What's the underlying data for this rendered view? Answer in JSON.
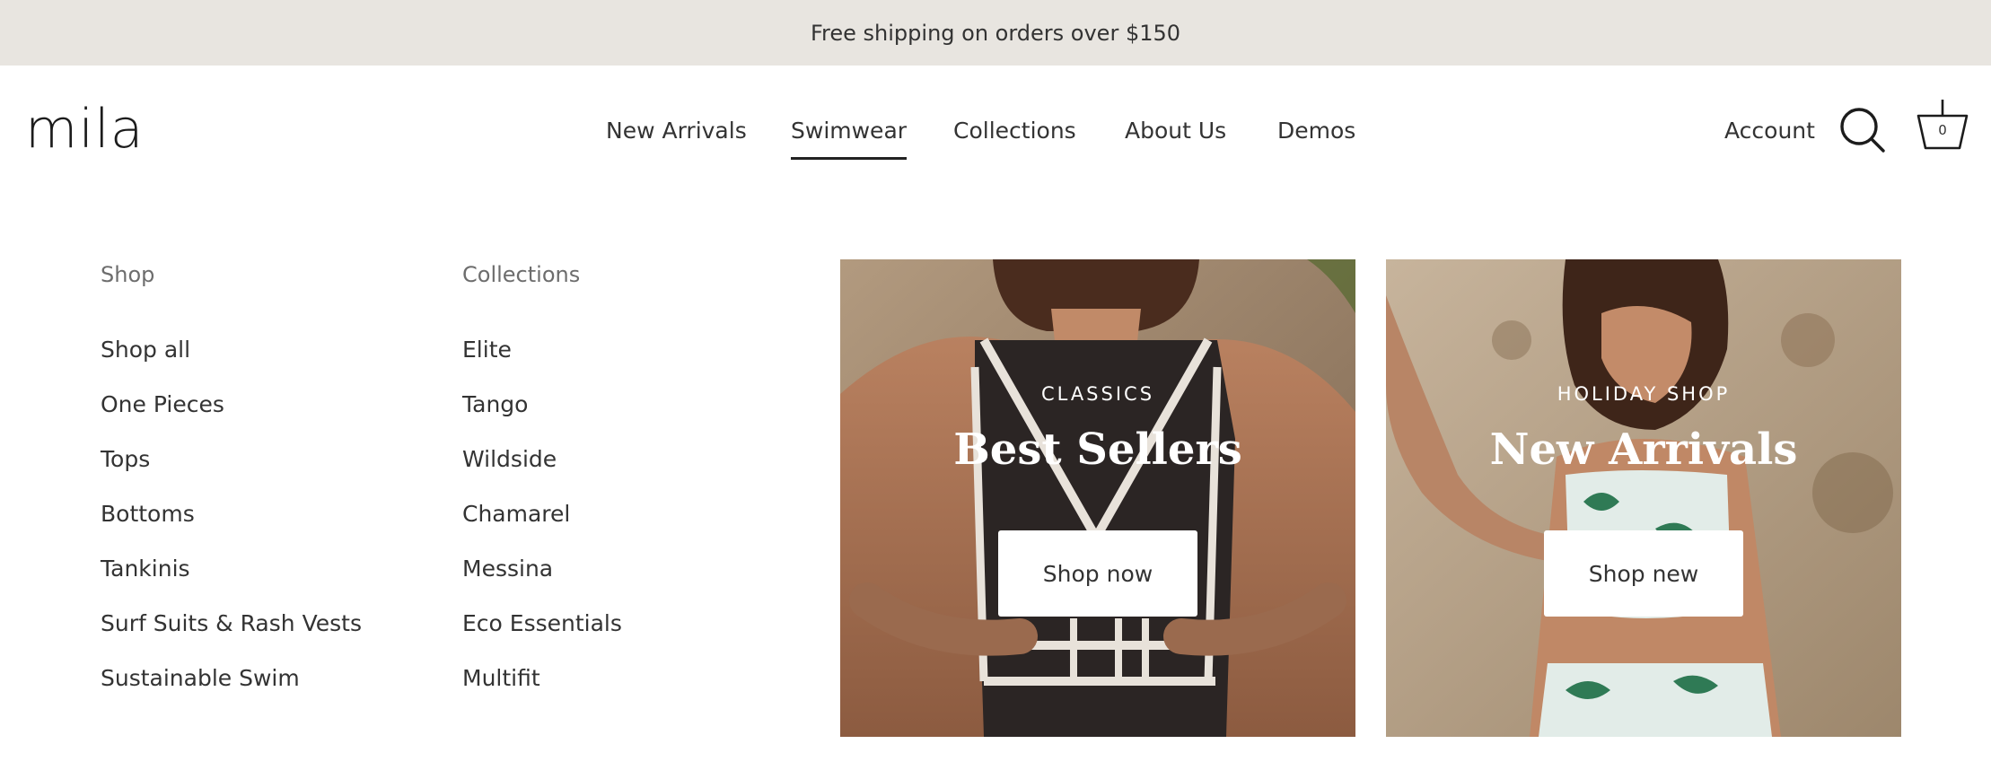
{
  "announcement": "Free shipping on orders over $150",
  "header": {
    "logo": "mila",
    "nav": [
      {
        "label": "New Arrivals"
      },
      {
        "label": "Swimwear"
      },
      {
        "label": "Collections"
      },
      {
        "label": "About Us"
      },
      {
        "label": "Demos"
      }
    ],
    "active_nav": "Swimwear",
    "account_label": "Account",
    "cart_count": "0"
  },
  "mega_menu": {
    "shop": {
      "heading": "Shop",
      "items": [
        "Shop all",
        "One Pieces",
        "Tops",
        "Bottoms",
        "Tankinis",
        "Surf Suits & Rash Vests",
        "Sustainable Swim"
      ]
    },
    "collections": {
      "heading": "Collections",
      "items": [
        "Elite",
        "Tango",
        "Wildside",
        "Chamarel",
        "Messina",
        "Eco Essentials",
        "Multifit"
      ]
    },
    "promos": [
      {
        "eyebrow": "CLASSICS",
        "title": "Best Sellers",
        "button": "Shop now"
      },
      {
        "eyebrow": "HOLIDAY SHOP",
        "title": "New Arrivals",
        "button": "Shop new"
      }
    ]
  },
  "colors": {
    "announcement_bg": "#e8e5e0",
    "text": "#333333",
    "muted": "#6d6d6d",
    "promo_text": "#ffffff"
  }
}
